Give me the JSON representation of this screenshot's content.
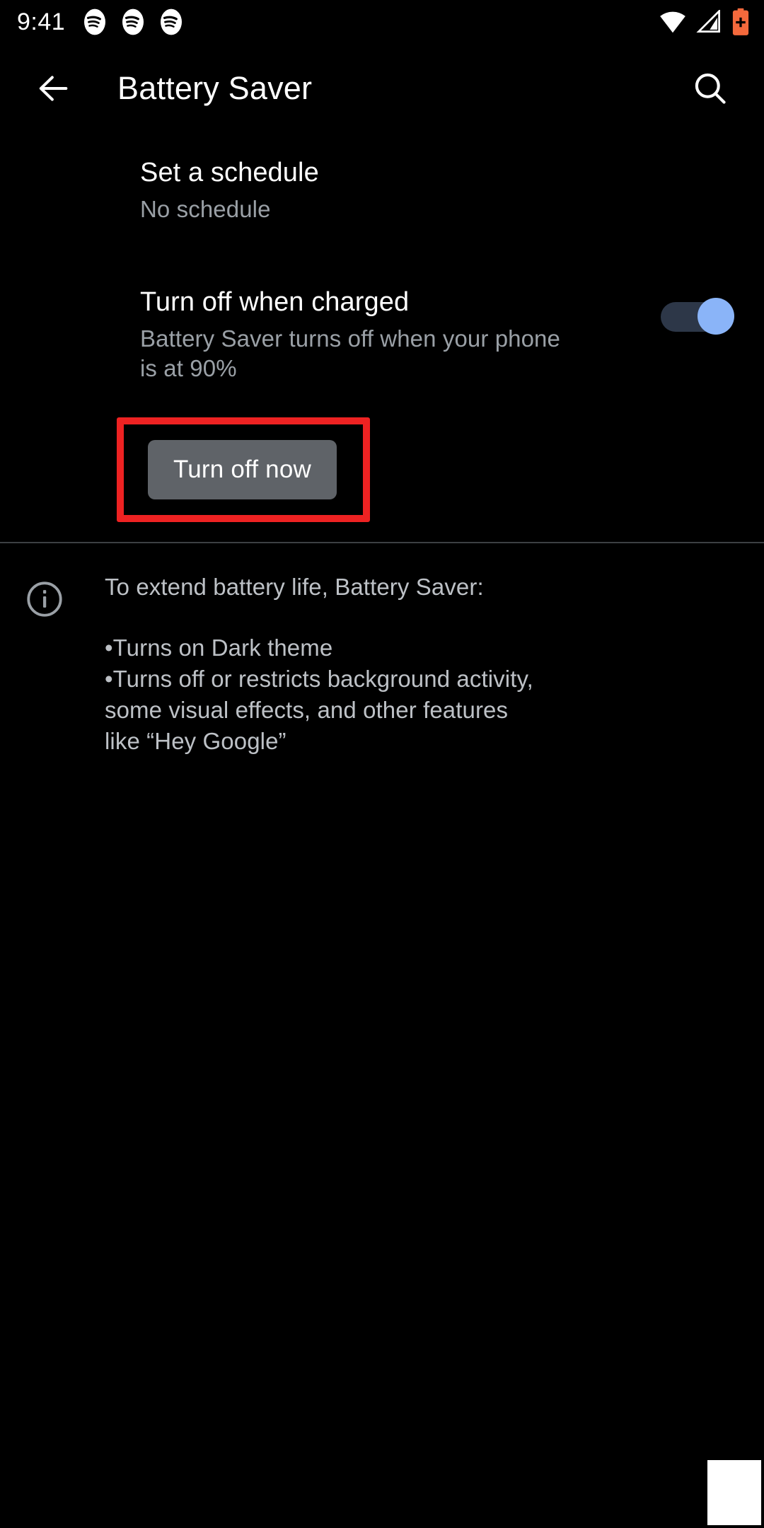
{
  "status_bar": {
    "time": "9:41",
    "left_icons": [
      "spotify-icon",
      "spotify-icon",
      "spotify-icon"
    ],
    "right_icons": [
      "wifi-icon",
      "cellular-signal-icon",
      "battery-saver-icon"
    ],
    "battery_icon_color": "#f4693c"
  },
  "app_bar": {
    "back_icon": "arrow-left-icon",
    "title": "Battery Saver",
    "search_icon": "search-icon"
  },
  "settings": {
    "schedule": {
      "title": "Set a schedule",
      "summary": "No schedule"
    },
    "turn_off_when_charged": {
      "title": "Turn off when charged",
      "summary": "Battery Saver turns off when your phone is at 90%",
      "toggle_state": "on",
      "toggle_thumb_color": "#8ab4f8",
      "toggle_track_color": "#2d3748"
    },
    "turn_off_now_button": {
      "label": "Turn off now",
      "background_color": "#5f6368"
    }
  },
  "highlight": {
    "color": "#ee2222",
    "target": "turn-off-now-button"
  },
  "footer": {
    "icon": "info-circle-icon",
    "lead": "To extend battery life, Battery Saver:",
    "bullets": "•Turns on Dark theme\n•Turns off or restricts background activity, some visual effects, and other features like “Hey Google”"
  },
  "theme": {
    "background": "#000000",
    "primary_text": "#ffffff",
    "secondary_text": "#9aa0a6",
    "divider": "#3c4043"
  }
}
